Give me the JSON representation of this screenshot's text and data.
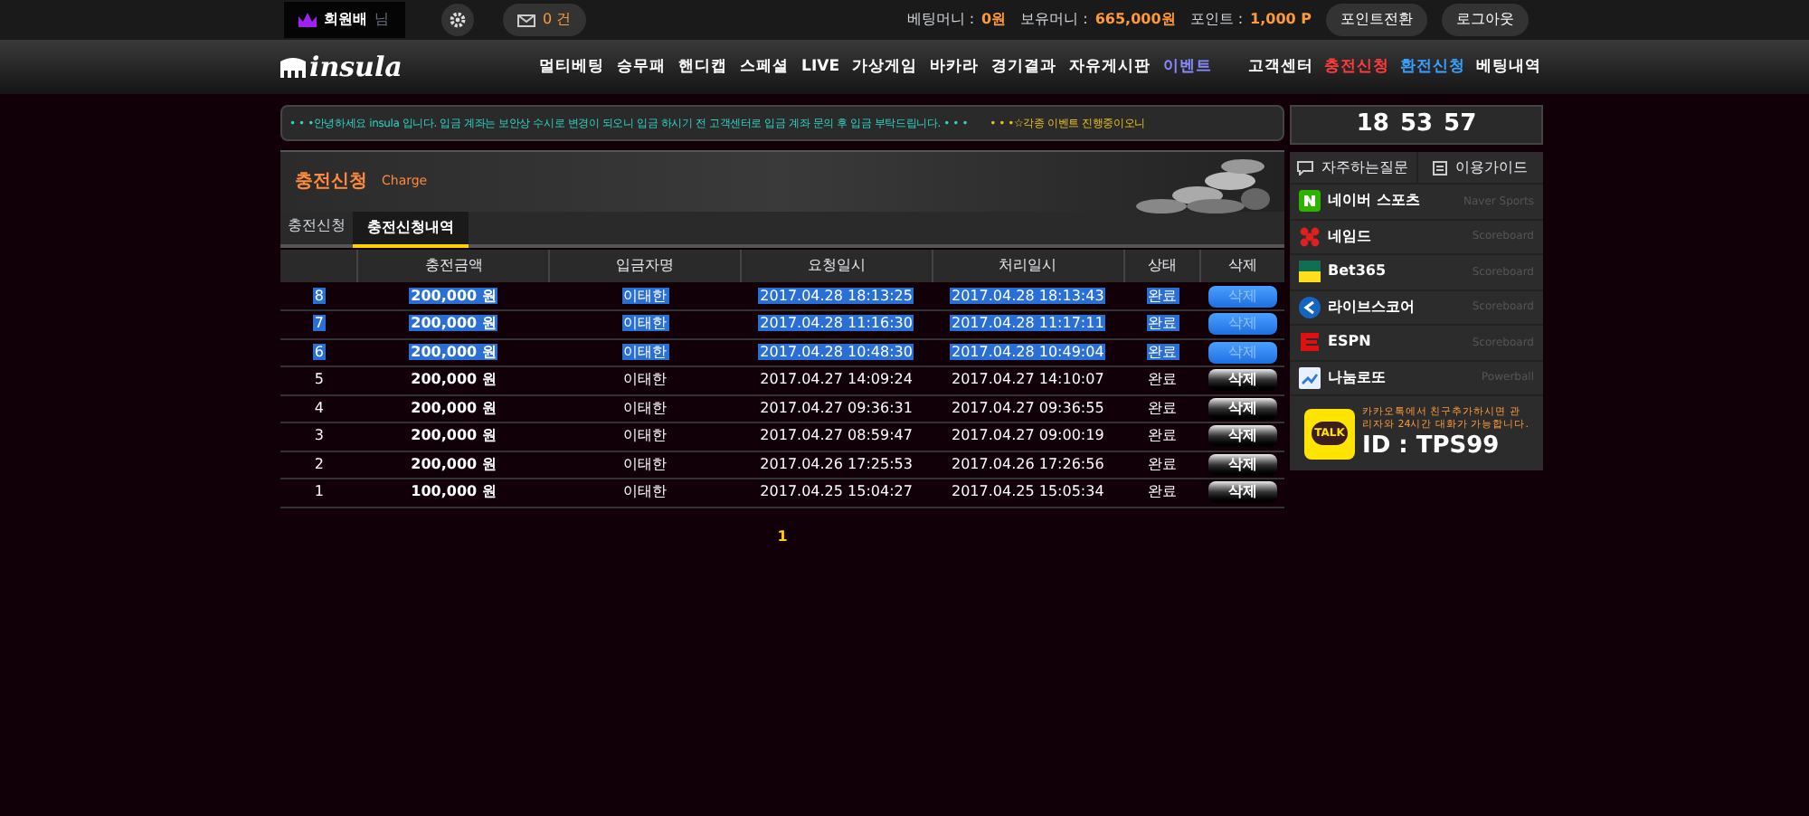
{
  "topbar": {
    "user": "회원배",
    "user_suffix": "님",
    "messages": "0 건",
    "betting_money_label": "베팅머니 :",
    "betting_money": "0원",
    "holding_money_label": "보유머니 :",
    "holding_money": "665,000원",
    "points_label": "포인트 :",
    "points": "1,000 P",
    "buttons": [
      "포인트전환",
      "로그아웃"
    ]
  },
  "logo": "insula",
  "nav": [
    {
      "label": "멀티베팅",
      "kind": "main"
    },
    {
      "label": "승무패",
      "kind": "main"
    },
    {
      "label": "핸디캡",
      "kind": "main"
    },
    {
      "label": "스페셜",
      "kind": "main"
    },
    {
      "label": "LIVE",
      "kind": "main"
    },
    {
      "label": "가상게임",
      "kind": "main"
    },
    {
      "label": "바카라",
      "kind": "main"
    },
    {
      "label": "경기결과",
      "kind": "main"
    },
    {
      "label": "자유게시판",
      "kind": "main"
    },
    {
      "label": "이벤트",
      "kind": "event"
    }
  ],
  "nav_right": [
    {
      "label": "고객센터",
      "color": "#ffffff"
    },
    {
      "label": "충전신청",
      "color": "#ff3b3b"
    },
    {
      "label": "환전신청",
      "color": "#3aa0ff"
    },
    {
      "label": "베팅내역",
      "color": "#ffffff"
    }
  ],
  "ticker": [
    {
      "text": "• • •안녕하세요 insula 입니다. 입금 계좌는 보안상 수시로 변경이 되오니 입금 하시기 전 고객센터로 입금 계좌 문의 후 입금 부탁드립니다. • • •",
      "color": "#2fd4c4"
    },
    {
      "text": "• • •☆각종 이벤트 진행중이오니",
      "color": "#e8c020"
    }
  ],
  "clock": [
    "18",
    "53",
    "57"
  ],
  "panel": {
    "title": "충전신청",
    "subtitle": "Charge"
  },
  "tabs": [
    {
      "label": "충전신청",
      "selected": false
    },
    {
      "label": "충전신청내역",
      "selected": true
    }
  ],
  "table": {
    "columns": [
      "충전금액",
      "입금자명",
      "요청일시",
      "처리일시",
      "상태",
      "삭제"
    ],
    "rows": [
      {
        "no": "8",
        "amount": "200,000 원",
        "name": "이태한",
        "requested": "2017.04.28 18:13:25",
        "processed": "2017.04.28 18:13:43",
        "status": "완료",
        "action": "삭제",
        "selected": true
      },
      {
        "no": "7",
        "amount": "200,000 원",
        "name": "이태한",
        "requested": "2017.04.28 11:16:30",
        "processed": "2017.04.28 11:17:11",
        "status": "완료",
        "action": "삭제",
        "selected": true
      },
      {
        "no": "6",
        "amount": "200,000 원",
        "name": "이태한",
        "requested": "2017.04.28 10:48:30",
        "processed": "2017.04.28 10:49:04",
        "status": "완료",
        "action": "삭제",
        "selected": true
      },
      {
        "no": "5",
        "amount": "200,000 원",
        "name": "이태한",
        "requested": "2017.04.27 14:09:24",
        "processed": "2017.04.27 14:10:07",
        "status": "완료",
        "action": "삭제",
        "selected": false
      },
      {
        "no": "4",
        "amount": "200,000 원",
        "name": "이태한",
        "requested": "2017.04.27 09:36:31",
        "processed": "2017.04.27 09:36:55",
        "status": "완료",
        "action": "삭제",
        "selected": false
      },
      {
        "no": "3",
        "amount": "200,000 원",
        "name": "이태한",
        "requested": "2017.04.27 08:59:47",
        "processed": "2017.04.27 09:00:19",
        "status": "완료",
        "action": "삭제",
        "selected": false
      },
      {
        "no": "2",
        "amount": "200,000 원",
        "name": "이태한",
        "requested": "2017.04.26 17:25:53",
        "processed": "2017.04.26 17:26:56",
        "status": "완료",
        "action": "삭제",
        "selected": false
      },
      {
        "no": "1",
        "amount": "100,000 원",
        "name": "이태한",
        "requested": "2017.04.25 15:04:27",
        "processed": "2017.04.25 15:05:34",
        "status": "완료",
        "action": "삭제",
        "selected": false
      }
    ]
  },
  "pagination": [
    {
      "label": "1",
      "selected": true
    }
  ],
  "side_tabs": [
    "자주하는질문",
    "이용가이드"
  ],
  "links": [
    {
      "name": "네이버 스포츠",
      "sub": "Naver Sports",
      "kind": "naver"
    },
    {
      "name": "네임드",
      "sub": "Scoreboard",
      "kind": "named"
    },
    {
      "name": "Bet365",
      "sub": "Scoreboard",
      "kind": "bet365"
    },
    {
      "name": "라이브스코어",
      "sub": "Scoreboard",
      "kind": "livescore"
    },
    {
      "name": "ESPN",
      "sub": "Scoreboard",
      "kind": "espn"
    },
    {
      "name": "나눔로또",
      "sub": "Powerball",
      "kind": "lotto"
    }
  ],
  "kakao": {
    "badge": "TALK",
    "text": "카카오톡에서 친구추가하시면 관리자와 24시간 대화가 가능합니다.",
    "id": "ID : TPS99"
  }
}
